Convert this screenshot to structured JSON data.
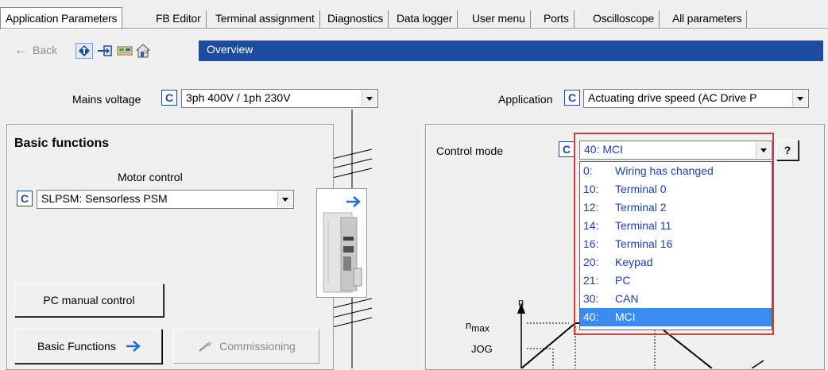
{
  "tabs": [
    {
      "label": "Application Parameters",
      "active": true
    },
    {
      "label": "FB Editor"
    },
    {
      "label": "Terminal assignment"
    },
    {
      "label": "Diagnostics"
    },
    {
      "label": "Data logger"
    },
    {
      "label": "User menu"
    },
    {
      "label": "Ports"
    },
    {
      "label": "Oscilloscope"
    },
    {
      "label": "All parameters"
    }
  ],
  "toolbar": {
    "back_label": "Back",
    "breadcrumb": "Overview"
  },
  "mains": {
    "label": "Mains voltage",
    "c_label": "C",
    "value": "3ph 400V / 1ph 230V"
  },
  "application": {
    "label": "Application",
    "c_label": "C",
    "value": "Actuating drive speed (AC Drive P"
  },
  "basic": {
    "title": "Basic functions",
    "motor_control_label": "Motor control",
    "c_label": "C",
    "motor_control_value": "SLPSM: Sensorless PSM",
    "pc_manual_button": "PC manual control",
    "basic_functions_button": "Basic Functions",
    "commissioning_button": "Commissioning"
  },
  "control": {
    "label": "Control mode",
    "c_label": "C",
    "value": "40:  MCI",
    "help_label": "?",
    "options": [
      {
        "code": "0:",
        "text": "Wiring has changed"
      },
      {
        "code": "10:",
        "text": "Terminal 0"
      },
      {
        "code": "12:",
        "text": "Terminal 2"
      },
      {
        "code": "14:",
        "text": "Terminal 11"
      },
      {
        "code": "16:",
        "text": "Terminal 16"
      },
      {
        "code": "20:",
        "text": "Keypad"
      },
      {
        "code": "21:",
        "text": "PC"
      },
      {
        "code": "30:",
        "text": "CAN"
      },
      {
        "code": "40:",
        "text": "MCI",
        "selected": true
      }
    ]
  },
  "diagram": {
    "n_label": "n",
    "nmax_n": "n",
    "nmax_sub": "max",
    "jog_label": "JOG"
  },
  "colors": {
    "accent": "#1c4ba0",
    "highlight": "#3a8bf0",
    "frame": "#d13c3c"
  }
}
